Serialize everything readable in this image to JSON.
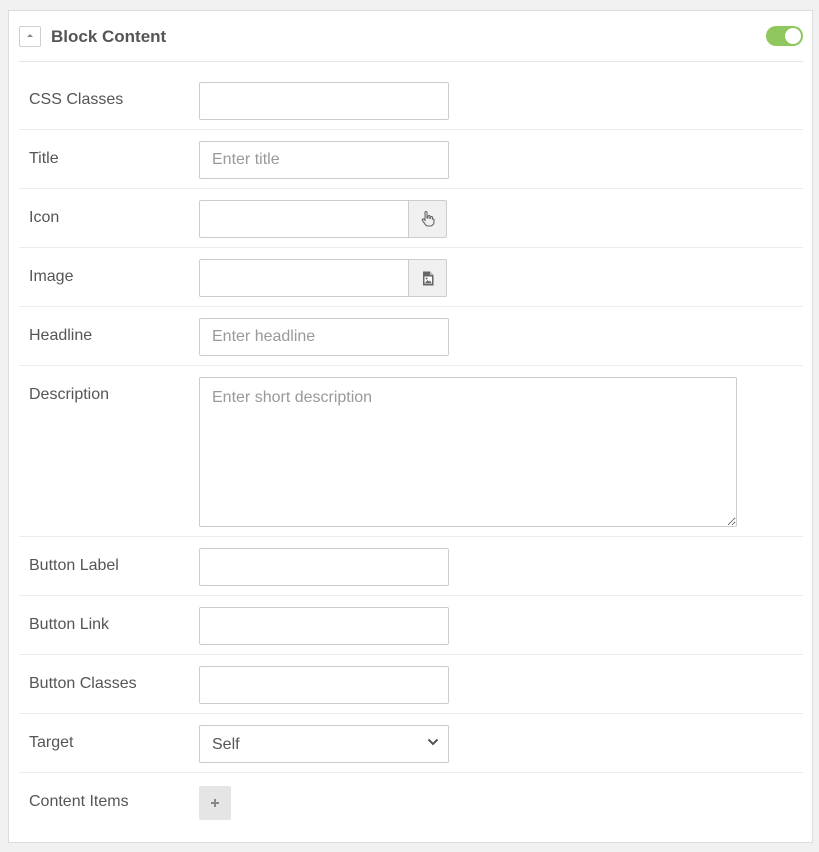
{
  "header": {
    "title": "Block Content",
    "enabled": true,
    "toggle_color": "#8fc75e"
  },
  "fields": {
    "css_classes": {
      "label": "CSS Classes",
      "value": "",
      "placeholder": ""
    },
    "title": {
      "label": "Title",
      "value": "",
      "placeholder": "Enter title"
    },
    "icon": {
      "label": "Icon",
      "value": "",
      "button_icon": "hand-pointer-icon"
    },
    "image": {
      "label": "Image",
      "value": "",
      "button_icon": "image-file-icon"
    },
    "headline": {
      "label": "Headline",
      "value": "",
      "placeholder": "Enter headline"
    },
    "description": {
      "label": "Description",
      "value": "",
      "placeholder": "Enter short description"
    },
    "button_label": {
      "label": "Button Label",
      "value": ""
    },
    "button_link": {
      "label": "Button Link",
      "value": ""
    },
    "button_classes": {
      "label": "Button Classes",
      "value": ""
    },
    "target": {
      "label": "Target",
      "selected": "Self"
    },
    "content_items": {
      "label": "Content Items",
      "add_icon": "plus-icon"
    }
  }
}
